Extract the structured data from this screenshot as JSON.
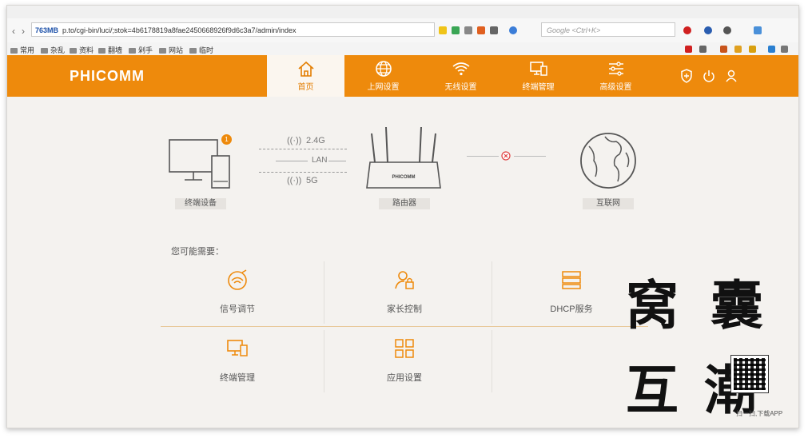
{
  "browser": {
    "memory": "763MB",
    "url": "p.to/cgi-bin/luci/;stok=4b6178819a8fae2450668926f9d6c3a7/admin/index",
    "search_placeholder": "Google <Ctrl+K>",
    "bookmarks": [
      "常用",
      "杂乱",
      "资料",
      "翻墙",
      "剁手",
      "网站",
      "临时"
    ]
  },
  "router": {
    "brand": "PHICOMM",
    "nav": [
      {
        "label": "首页",
        "icon": "home-icon",
        "active": true
      },
      {
        "label": "上网设置",
        "icon": "globe-icon",
        "active": false
      },
      {
        "label": "无线设置",
        "icon": "wifi-icon",
        "active": false
      },
      {
        "label": "终端管理",
        "icon": "devices-icon",
        "active": false
      },
      {
        "label": "高级设置",
        "icon": "sliders-icon",
        "active": false
      }
    ],
    "header_icons": [
      "shield-icon",
      "power-icon",
      "user-icon"
    ],
    "accent": "#ee8a0c"
  },
  "topology": {
    "device_label": "终端设备",
    "device_badge": "1",
    "band_24": "2.4G",
    "lan": "LAN",
    "band_5": "5G",
    "router_label": "路由器",
    "router_brand": "PHICOMM",
    "internet_label": "互联网",
    "internet_status": "disconnected"
  },
  "services": {
    "heading": "您可能需要：",
    "items": [
      {
        "label": "信号调节",
        "icon": "signal-tune-icon"
      },
      {
        "label": "家长控制",
        "icon": "parental-control-icon"
      },
      {
        "label": "DHCP服务",
        "icon": "dhcp-server-icon"
      },
      {
        "label": "终端管理",
        "icon": "devices-icon"
      },
      {
        "label": "应用设置",
        "icon": "apps-grid-icon"
      }
    ]
  },
  "watermark": {
    "chars": [
      "窝",
      "囊",
      "互",
      "潮"
    ],
    "qr_caption": "扫一扫,下载APP"
  }
}
